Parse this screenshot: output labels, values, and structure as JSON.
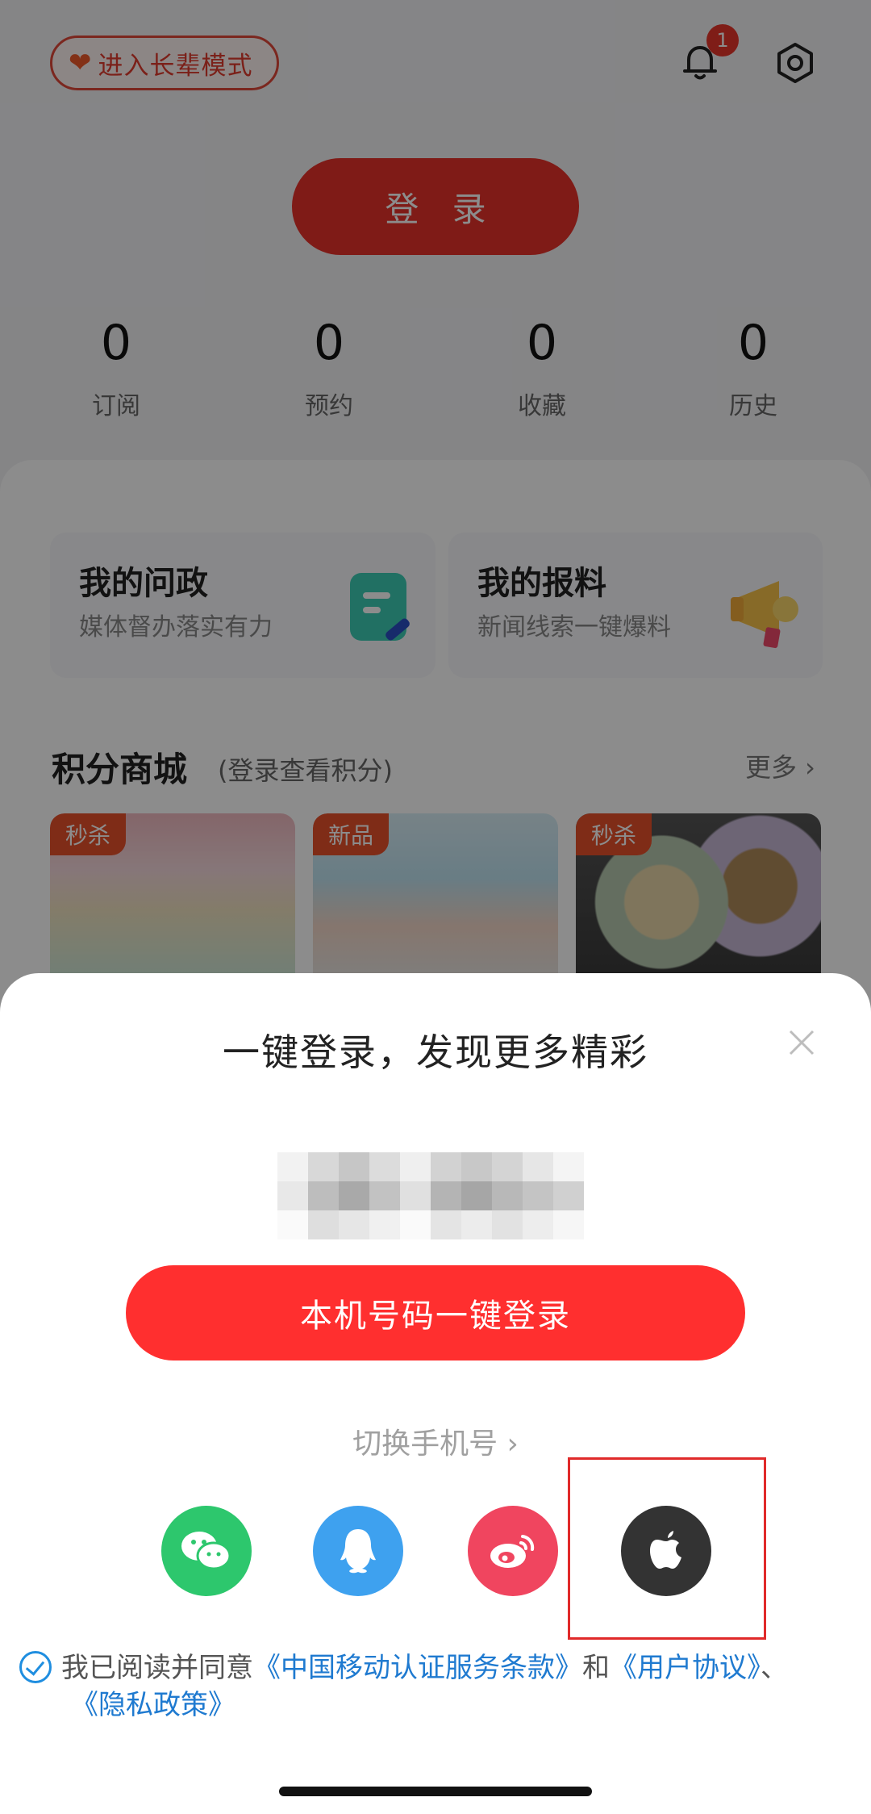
{
  "header": {
    "elder_mode_label": "进入长辈模式",
    "notification_count": "1"
  },
  "login_button_label": "登 录",
  "stats": [
    {
      "value": "0",
      "label": "订阅"
    },
    {
      "value": "0",
      "label": "预约"
    },
    {
      "value": "0",
      "label": "收藏"
    },
    {
      "value": "0",
      "label": "历史"
    }
  ],
  "cards": [
    {
      "title": "我的问政",
      "subtitle": "媒体督办落实有力"
    },
    {
      "title": "我的报料",
      "subtitle": "新闻线索一键爆料"
    }
  ],
  "mall": {
    "title": "积分商城",
    "subtitle": "(登录查看积分)",
    "more_label": "更多 ›",
    "products": [
      {
        "tag": "秒杀"
      },
      {
        "tag": "新品"
      },
      {
        "tag": "秒杀"
      }
    ]
  },
  "sheet": {
    "title": "一键登录，发现更多精彩",
    "one_key_label": "本机号码一键登录",
    "switch_label": "切换手机号 ›",
    "social": [
      "wechat-icon",
      "qq-icon",
      "weibo-icon",
      "apple-icon"
    ],
    "agreement": {
      "prefix": "我已阅读并同意",
      "link1": "《中国移动认证服务条款》",
      "and": "和",
      "link2": "《用户协议》",
      "sep": "、",
      "link3": "《隐私政策》"
    }
  },
  "colors": {
    "brand_red": "#e8322b",
    "button_red": "#ff2f2f",
    "link_blue": "#1f7ad0",
    "wechat_green": "#2dc76d",
    "qq_blue": "#3ea1ef",
    "weibo_red": "#f0455f",
    "apple_dark": "#333333"
  }
}
